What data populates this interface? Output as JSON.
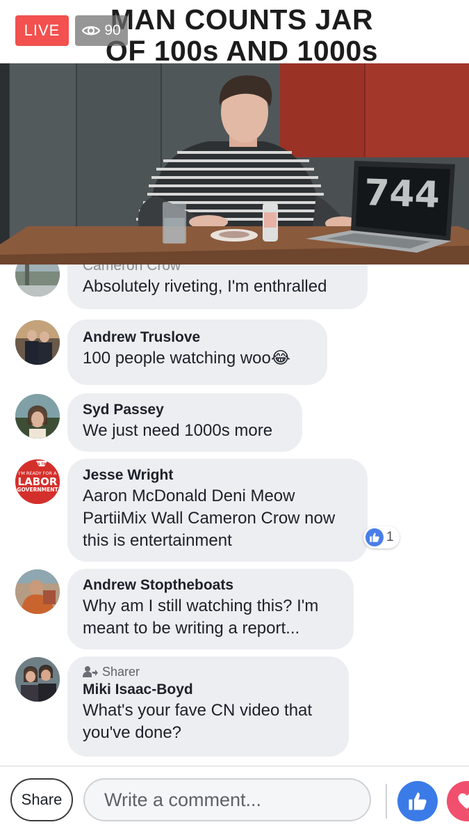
{
  "header": {
    "title_line1": "MAN COUNTS JAR",
    "title_line2": "OF 100s AND 1000s",
    "live_label": "LIVE",
    "viewer_count": "90",
    "live_color": "#f2514f"
  },
  "video": {
    "laptop_counter": "744"
  },
  "comments": [
    {
      "name": "Cameron Crow",
      "lines": [
        "Absolutely riveting, I'm enthralled"
      ]
    },
    {
      "name": "Andrew Truslove",
      "lines": [
        "100 people watching woo"
      ],
      "emoji": "😂"
    },
    {
      "name": "Syd Passey",
      "lines": [
        "We just need 1000s more"
      ]
    },
    {
      "name": "Jesse Wright",
      "lines": [
        "Aaron McDonald Deni Meow",
        "PartiiMix Wall Cameron Crow now",
        "this is entertainment"
      ],
      "reaction_count": "1",
      "avatar_text": [
        "IT'S TIME",
        "I'M READY FOR A",
        "LABOR",
        "GOVERNMENT"
      ]
    },
    {
      "name": "Andrew Stoptheboats",
      "lines": [
        "Why am I still watching this? I'm",
        "meant to be writing a report..."
      ]
    },
    {
      "name": "Miki Isaac-Boyd",
      "sharer_label": "Sharer",
      "lines": [
        "What's your fave CN video that",
        "you've done?"
      ]
    }
  ],
  "bottom_bar": {
    "share_label": "Share",
    "comment_placeholder": "Write a comment...",
    "like_color": "#3b7be8",
    "love_color": "#f0506e"
  }
}
